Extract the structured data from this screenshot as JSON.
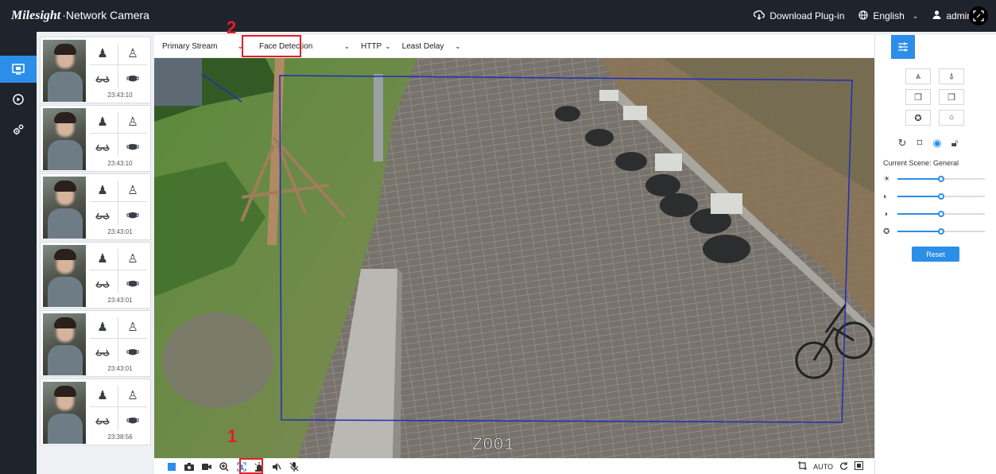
{
  "app": {
    "brand": "Milesight",
    "product": "·Network Camera"
  },
  "topbar": {
    "download_label": "Download Plug-in",
    "language_label": "English",
    "user_label": "admin"
  },
  "nav": {
    "items": [
      {
        "icon": "live-view-icon",
        "active": true
      },
      {
        "icon": "playback-icon",
        "active": false
      },
      {
        "icon": "settings-gear-icon",
        "active": false
      }
    ]
  },
  "stream": {
    "stream_label": "Primary Stream",
    "mode_label": "Face Detection",
    "protocol_label": "HTTP",
    "delay_label": "Least Delay"
  },
  "captures": [
    {
      "time": "23:43:10"
    },
    {
      "time": "23:43:10"
    },
    {
      "time": "23:43:01"
    },
    {
      "time": "23:43:01"
    },
    {
      "time": "23:43:01"
    },
    {
      "time": "23:38:56"
    }
  ],
  "video": {
    "zone_label": "Z001"
  },
  "toolbar": {
    "auto_label": "AUTO"
  },
  "panel": {
    "scene_label": "Current Scene: General",
    "reset_label": "Reset",
    "slider_levels": [
      0.5,
      0.5,
      0.5,
      0.5
    ]
  },
  "annotations": {
    "step1": "1",
    "step2": "2"
  },
  "colors": {
    "accent": "#2b8ee8",
    "annotation": "#e31f26",
    "zone": "#1f2fb8"
  }
}
